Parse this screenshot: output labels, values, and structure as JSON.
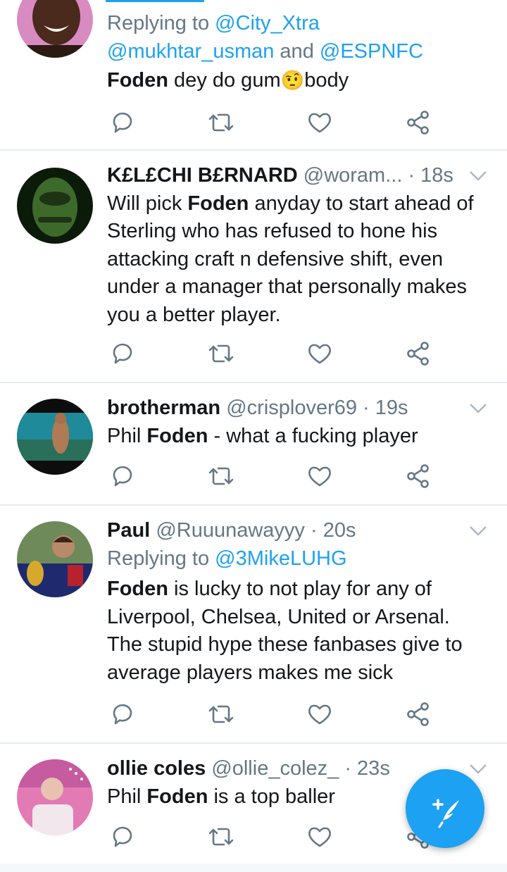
{
  "tweets": [
    {
      "reply_prefix": "Replying to ",
      "reply_handle_1": "@City_Xtra",
      "reply_line2_handle_a": "@mukhtar_usman",
      "reply_line2_and": " and ",
      "reply_line2_handle_b": "@ESPNFC",
      "text_bold": "Foden",
      "text_rest_a": " dey do gum",
      "emoji": "🤨",
      "text_rest_b": "body"
    },
    {
      "name": "K£L£CHI B£RNARD",
      "handle": "@woram...",
      "time": "· 18s",
      "text_lines": [
        {
          "bold_after": "Will pick ",
          "bold": "Foden",
          "rest": " anyday to start ahead of"
        },
        "Sterling who has refused to hone his",
        "attacking craft n defensive shift, even",
        "under a manager that personally makes",
        "you a better player."
      ]
    },
    {
      "name": "brotherman",
      "handle": "@crisplover69",
      "time": "· 19s",
      "pre": "Phil ",
      "bold": "Foden",
      "rest": " - what a fucking player"
    },
    {
      "name": "Paul",
      "handle": "@Ruuunawayyy",
      "time": "· 20s",
      "reply_prefix": "Replying to ",
      "reply_handle": "@3MikeLUHG",
      "bold": "Foden",
      "line1_rest": " is lucky to not play for any of",
      "line2": "Liverpool, Chelsea, United or Arsenal.",
      "line3": "The stupid hype these fanbases give to",
      "line4": "average players makes me sick"
    },
    {
      "name": "ollie coles",
      "handle": "@ollie_colez_",
      "time": "· 23s",
      "pre": "Phil ",
      "bold": "Foden",
      "rest": " is a top baller"
    }
  ],
  "icons": {
    "reply": "reply-icon",
    "retweet": "retweet-icon",
    "like": "heart-icon",
    "share": "share-icon",
    "compose": "compose-tweet-icon"
  },
  "colors": {
    "accent": "#1da1f2",
    "muted": "#657786",
    "icon": "#657786",
    "divider": "#e6ecf0"
  }
}
